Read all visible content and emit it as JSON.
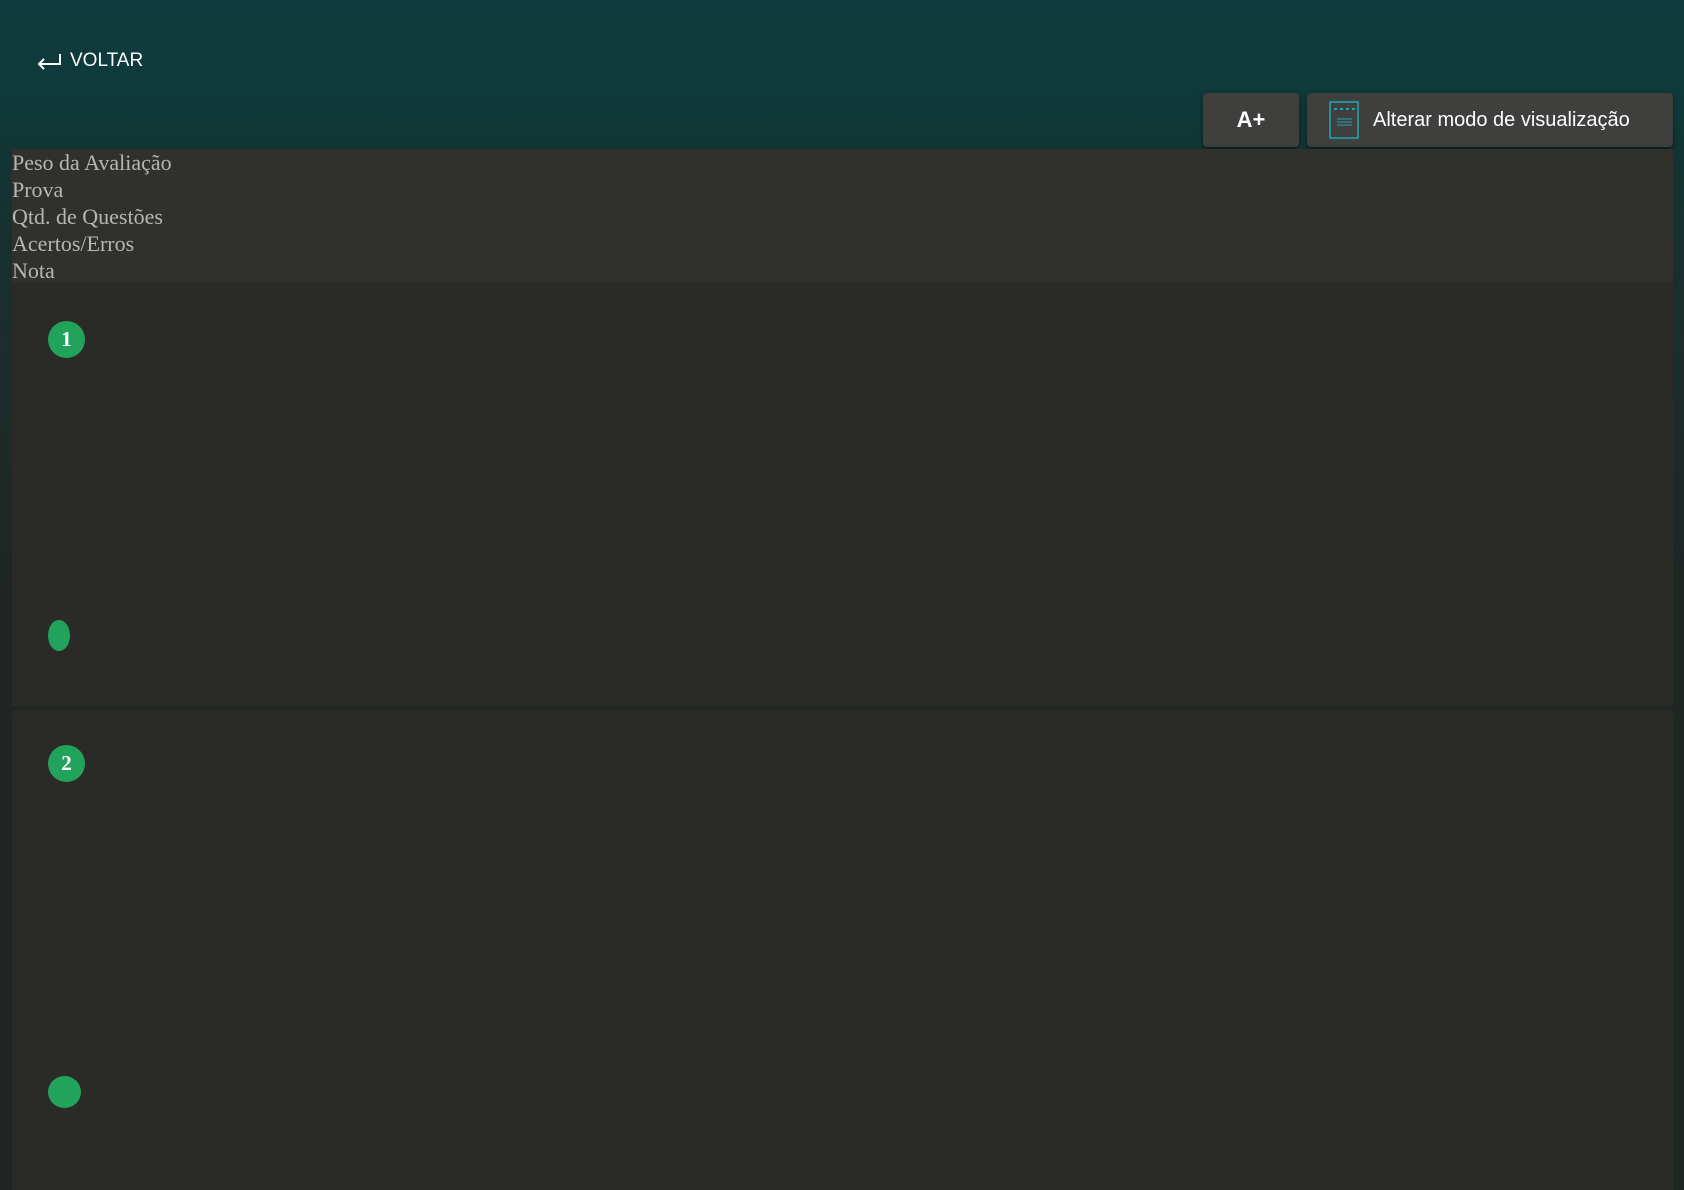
{
  "header": {
    "back_label": "VOLTAR",
    "font_button_label": "A+",
    "view_mode_label": "Alterar modo de visualização"
  },
  "summary": {
    "rows": [
      "Peso da Avaliação",
      "Prova",
      "Qtd. de Questões",
      "Acertos/Erros",
      "Nota"
    ]
  },
  "questions": [
    {
      "number": "1"
    },
    {
      "number": "2"
    }
  ],
  "colors": {
    "accent_green": "#21a35c",
    "header_teal": "#0d3a3d",
    "button_bg": "#3f3f3e",
    "card_bg": "#2a2a27"
  },
  "icons": {
    "back": "return-arrow-icon",
    "view_mode": "document-icon"
  }
}
